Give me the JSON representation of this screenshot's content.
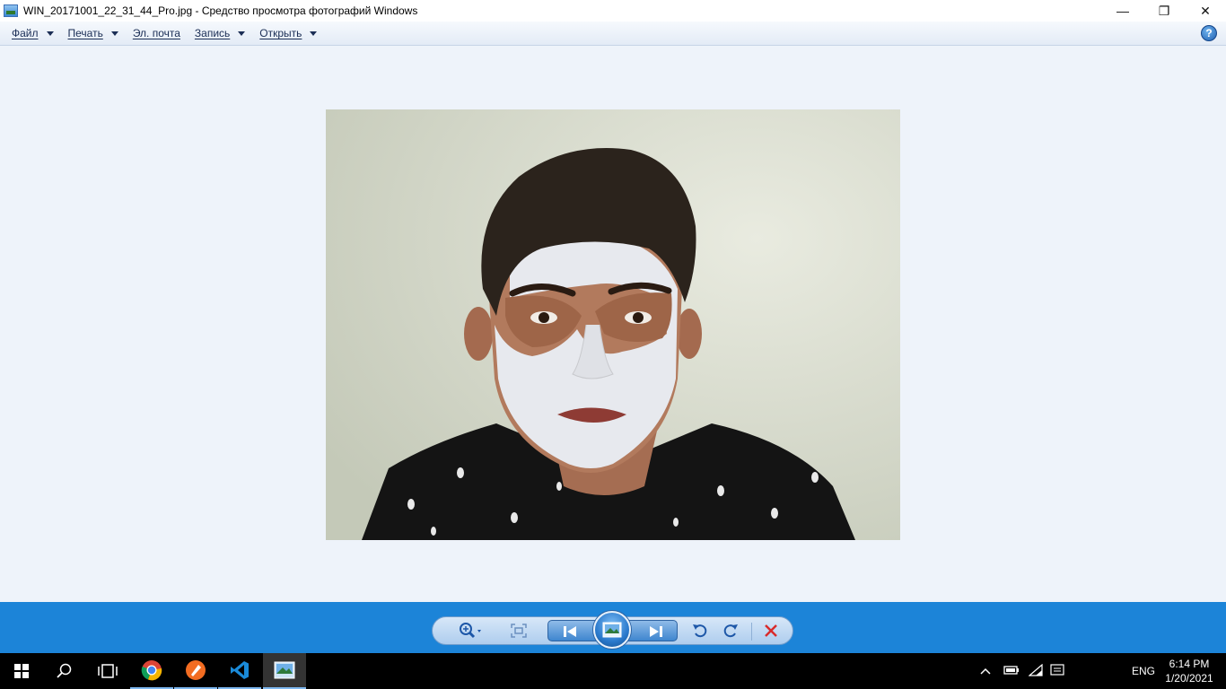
{
  "window": {
    "title": "WIN_20171001_22_31_44_Pro.jpg - Средство просмотра фотографий Windows",
    "minimize_glyph": "—",
    "restore_glyph": "❐",
    "close_glyph": "✕"
  },
  "menu": {
    "items": [
      {
        "label": "Файл",
        "has_dropdown": true
      },
      {
        "label": "Печать",
        "has_dropdown": true
      },
      {
        "label": "Эл. почта",
        "has_dropdown": false
      },
      {
        "label": "Запись",
        "has_dropdown": true
      },
      {
        "label": "Открыть",
        "has_dropdown": true
      }
    ],
    "help_glyph": "?"
  },
  "viewer": {
    "photo_subject": "young man with a white clay face mask"
  },
  "controls": {
    "icons": [
      "zoom-icon",
      "fit-window-icon",
      "previous-icon",
      "slideshow-icon",
      "next-icon",
      "rotate-left-icon",
      "rotate-right-icon",
      "delete-icon"
    ]
  },
  "taskbar": {
    "apps": [
      "start-icon",
      "search-icon",
      "task-view-icon",
      "chrome-icon",
      "pen-app-icon",
      "vscode-icon",
      "photo-viewer-icon"
    ],
    "language": "ENG",
    "time": "6:14 PM",
    "date": "1/20/2021"
  },
  "colors": {
    "accent": "#1c84d8",
    "viewer_bg": "#eef3fa",
    "delete_red": "#d92b2b"
  }
}
